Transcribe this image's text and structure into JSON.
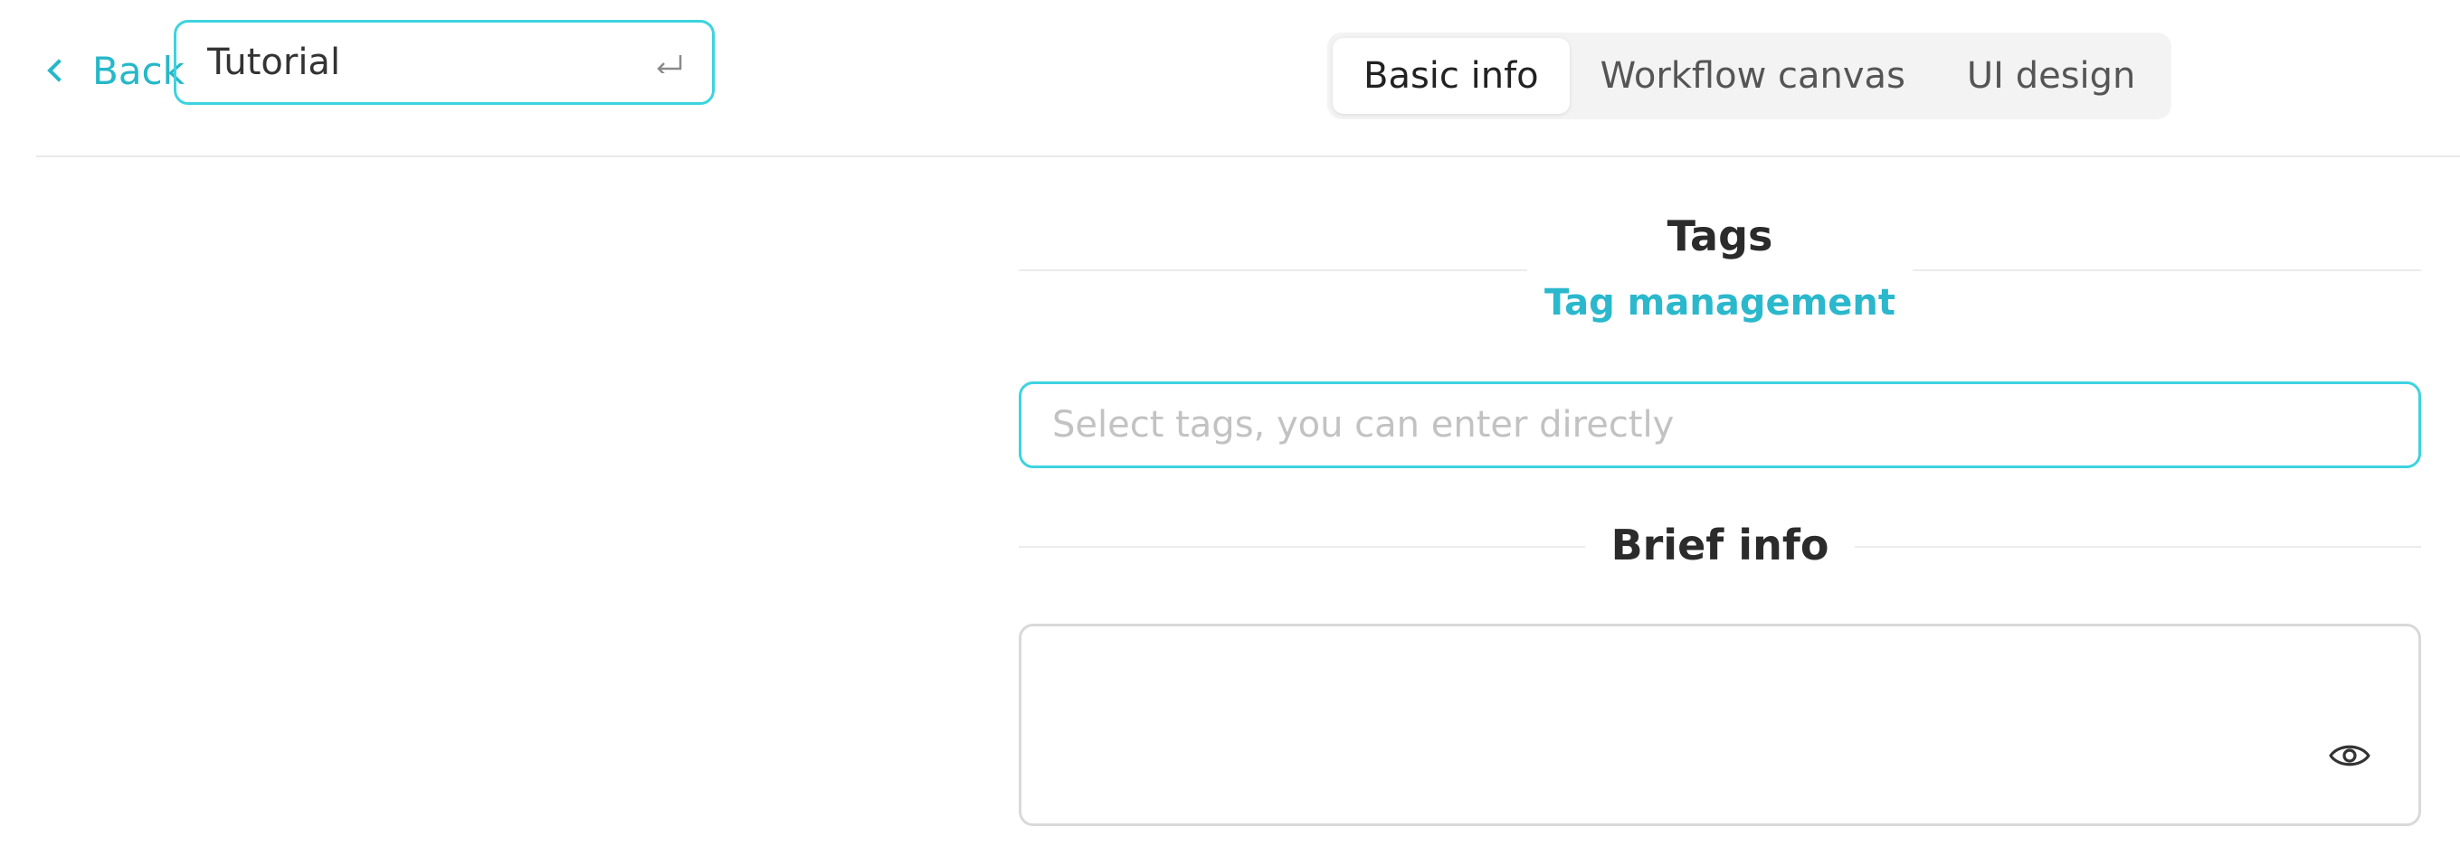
{
  "header": {
    "back_label": "Back",
    "title_value": "Tutorial",
    "tabs": [
      {
        "label": "Basic info",
        "active": true
      },
      {
        "label": "Workflow canvas",
        "active": false
      },
      {
        "label": "UI design",
        "active": false
      }
    ]
  },
  "tags_section": {
    "title": "Tags",
    "management_link": "Tag management",
    "select_placeholder": "Select tags, you can enter directly"
  },
  "brief_section": {
    "title": "Brief info",
    "value": ""
  },
  "icons": {
    "back": "chevron-left-icon",
    "enter": "enter-key-icon",
    "preview": "eye-icon"
  },
  "colors": {
    "accent": "#26b8c9",
    "focus_border": "#3dd3e0",
    "tab_bar_bg": "#f3f3f3"
  }
}
